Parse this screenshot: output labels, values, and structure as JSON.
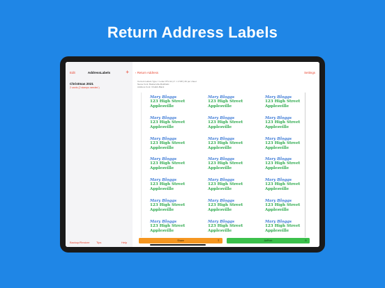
{
  "headline": "Return Address Labels",
  "status": {
    "time": "2:02 PM  Wed Mar 10",
    "battery": "▂▃▅ 100%"
  },
  "sidebar": {
    "edit": "Edit",
    "title": "AddressLabels",
    "add_icon": "+",
    "items": [
      {
        "title": "Christmas 2021",
        "subtitle": "2 cards (2 stamps needed )"
      }
    ],
    "footer": {
      "backup": "Backup/Restore",
      "tips": "Tips",
      "help": "Help"
    }
  },
  "main": {
    "back": "Return Address",
    "settings": "Settings",
    "info_lines": [
      "Current Labels Type = Letter 8½×11 (1\" × 2 5/8\") 30 per sheet",
      "Name Font: Baskerville-BoldItalic",
      "Address Font: Chalkb-Black"
    ]
  },
  "label": {
    "name": "Mary Bloggs",
    "street": "123 High Street",
    "city": "Applesville"
  },
  "labels_grid": {
    "columns": 3,
    "rows": 7
  },
  "buttons": {
    "share": "Share",
    "airprint": "AirPrint"
  },
  "colors": {
    "background": "#1f86e6",
    "accent": "#e8432e",
    "name": "#3d7ad6",
    "address": "#2aa84a",
    "share": "#f59620",
    "airprint": "#3bc04b"
  },
  "icons": {
    "share": "share-icon",
    "airprint": "airprint-icon",
    "back": "chevron-left-icon",
    "add": "plus-icon"
  }
}
